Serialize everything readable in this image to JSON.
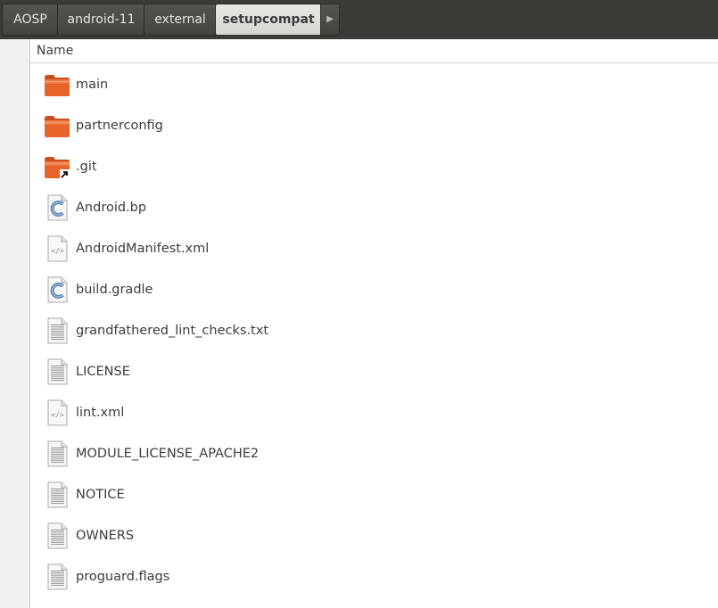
{
  "breadcrumb": {
    "items": [
      "AOSP",
      "android-11",
      "external",
      "setupcompat"
    ],
    "current_index": 3
  },
  "list_header": {
    "name_label": "Name"
  },
  "files": [
    {
      "name": "main",
      "type": "folder"
    },
    {
      "name": "partnerconfig",
      "type": "folder"
    },
    {
      "name": ".git",
      "type": "folder-link"
    },
    {
      "name": "Android.bp",
      "type": "c-source"
    },
    {
      "name": "AndroidManifest.xml",
      "type": "xml"
    },
    {
      "name": "build.gradle",
      "type": "c-source"
    },
    {
      "name": "grandfathered_lint_checks.txt",
      "type": "text"
    },
    {
      "name": "LICENSE",
      "type": "text"
    },
    {
      "name": "lint.xml",
      "type": "xml"
    },
    {
      "name": "MODULE_LICENSE_APACHE2",
      "type": "text"
    },
    {
      "name": "NOTICE",
      "type": "text"
    },
    {
      "name": "OWNERS",
      "type": "text"
    },
    {
      "name": "proguard.flags",
      "type": "text"
    }
  ],
  "colors": {
    "folder": "#e8632a",
    "accent": "#df4a16",
    "chrome": "#3c3b37"
  }
}
